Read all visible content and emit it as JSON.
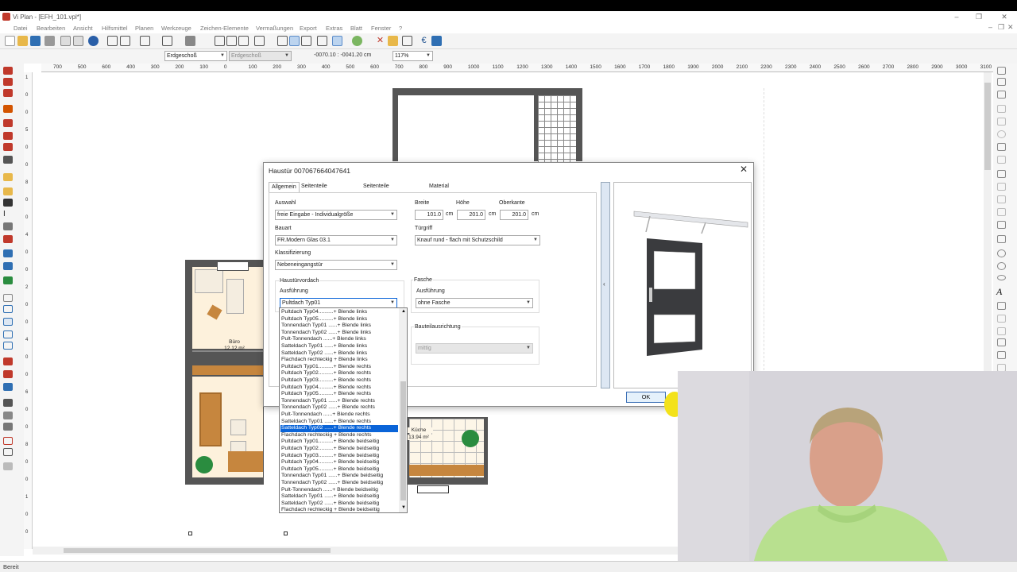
{
  "window": {
    "title": "Vi Plan - [EFH_101.vpl*]"
  },
  "menu": [
    "Datei",
    "Bearbeiten",
    "Ansicht",
    "Hilfsmittel",
    "Planen",
    "Werkzeuge",
    "Zeichen-Elemente",
    "Vermaßungen",
    "Export",
    "Extras",
    "Blatt",
    "Fenster",
    "?"
  ],
  "toolbar2": {
    "floor1": "Erdgeschoß",
    "floor2": "Erdgeschoß",
    "coords": "-0070.10 : -0041.20 cm",
    "zoom": "117%"
  },
  "ruler": [
    "700",
    "500",
    "600",
    "400",
    "300",
    "200",
    "100",
    "0",
    "100",
    "200",
    "300",
    "400",
    "500",
    "600",
    "700",
    "800",
    "900",
    "1000",
    "1100",
    "1200",
    "1300",
    "1400",
    "1500",
    "1600",
    "1700",
    "1800",
    "1900",
    "2000",
    "2100",
    "2200",
    "2300",
    "2400",
    "2500",
    "2600",
    "2700",
    "2800",
    "2900",
    "3000",
    "3100",
    "3200"
  ],
  "rooms": {
    "buero_name": "Büro",
    "buero_area": "12.12 m²",
    "kueche_name": "Küche",
    "kueche_area": "13.94 m²"
  },
  "dialog": {
    "title": "Haustür 007067664047641",
    "tabs": [
      "Allgemein",
      "Seitenteile am Schloss",
      "Seitenteile am Anschlag",
      "Material"
    ],
    "auswahl_label": "Auswahl",
    "auswahl_value": "freie Eingabe - Individualgröße",
    "bauart_label": "Bauart",
    "bauart_value": "FR.Modern Glas 03.1",
    "klass_label": "Klassifizierung",
    "klass_value": "Nebeneingangstür",
    "breite_label": "Breite",
    "breite_value": "101.0",
    "hoehe_label": "Höhe",
    "hoehe_value": "201.0",
    "oberkante_label": "Oberkante",
    "oberkante_value": "201.0",
    "unit": "cm",
    "tuergriff_label": "Türgriff",
    "tuergriff_value": "Knauf rund - flach mit Schutzschild",
    "vordach_group": "Haustürvordach",
    "ausfuehrung_label": "Ausführung",
    "vordach_value": "Pultdach Typ01",
    "fasche_group": "Fasche",
    "fasche_ausf_label": "Ausführung",
    "fasche_value": "ohne Fasche",
    "bauteil_label": "Bauteilausrichtung",
    "bauteil_value": "mittig",
    "ok": "OK"
  },
  "dropdown_items": [
    "Pultdach Typ04..........+ Blende links",
    "Pultdach Typ05..........+ Blende links",
    "Tonnendach Typ01  ......+ Blende links",
    "Tonnendach Typ02  ......+ Blende links",
    "Pult-Tonnendach    ......+ Blende links",
    "Satteldach Typ01  ......+ Blende links",
    "Satteldach Typ02  ......+ Blende links",
    "Flachdach rechteckig  + Blende links",
    "Pultdach Typ01..........+ Blende rechts",
    "Pultdach Typ02..........+ Blende rechts",
    "Pultdach Typ03..........+ Blende rechts",
    "Pultdach Typ04..........+ Blende rechts",
    "Pultdach Typ05..........+ Blende rechts",
    "Tonnendach Typ01  ......+ Blende rechts",
    "Tonnendach Typ02  ......+ Blende rechts",
    "Pult-Tonnendach    ......+ Blende rechts",
    "Satteldach Typ01  ......+ Blende rechts",
    "Satteldach Typ02  ......+ Blende rechts",
    "Flachdach rechteckig  + Blende rechts",
    "Pultdach Typ01..........+ Blende beidseitig",
    "Pultdach Typ02..........+ Blende beidseitig",
    "Pultdach Typ03..........+ Blende beidseitig",
    "Pultdach Typ04..........+ Blende beidseitig",
    "Pultdach Typ05..........+ Blende beidseitig",
    "Tonnendach Typ01  ......+ Blende beidseitig",
    "Tonnendach Typ02  ......+ Blende beidseitig",
    "Pult-Tonnendach    ......+ Blende beidseitig",
    "Satteldach Typ01  ......+ Blende beidseitig",
    "Satteldach Typ02  ......+ Blende beidseitig",
    "Flachdach rechteckig  + Blende beidseitig"
  ],
  "dropdown_selected_index": 17,
  "status": "Bereit"
}
